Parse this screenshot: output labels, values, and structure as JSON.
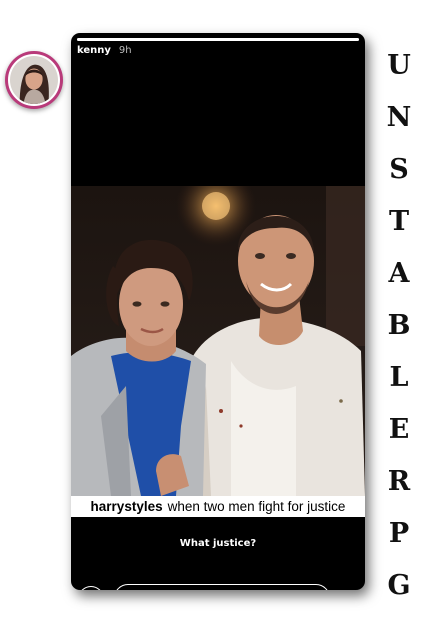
{
  "story": {
    "username": "kenny",
    "time": "9h",
    "progress": 1.0,
    "caption": {
      "user": "harrystyles",
      "text": "when two men fight for justice"
    },
    "reply_text": "What justice?"
  },
  "composer": {
    "message_value": "",
    "camera_icon": "camera-icon",
    "more_icon": "more-vertical-icon",
    "send_icon": "send-icon"
  },
  "watermark": {
    "letters": [
      "U",
      "N",
      "S",
      "T",
      "A",
      "B",
      "L",
      "E",
      "R",
      "P",
      "G"
    ]
  },
  "colors": {
    "story_background": "#000000",
    "avatar_ring": "#b93a7a",
    "caption_background": "#ffffff",
    "page_background": "#ffffff"
  }
}
